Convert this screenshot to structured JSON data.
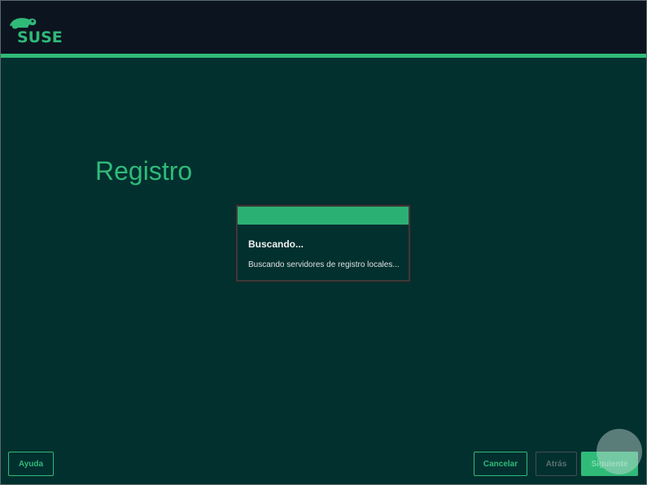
{
  "header": {
    "logo_text": "SUSE"
  },
  "page": {
    "title": "Registro"
  },
  "dialog": {
    "heading": "Buscando...",
    "message": "Buscando servidores de registro locales..."
  },
  "buttons": {
    "help": "Ayuda",
    "cancel": "Cancelar",
    "back": "Atrás",
    "next": "Siguiente"
  },
  "colors": {
    "accent": "#30ba78",
    "background": "#02302f",
    "header": "#0c1420"
  }
}
